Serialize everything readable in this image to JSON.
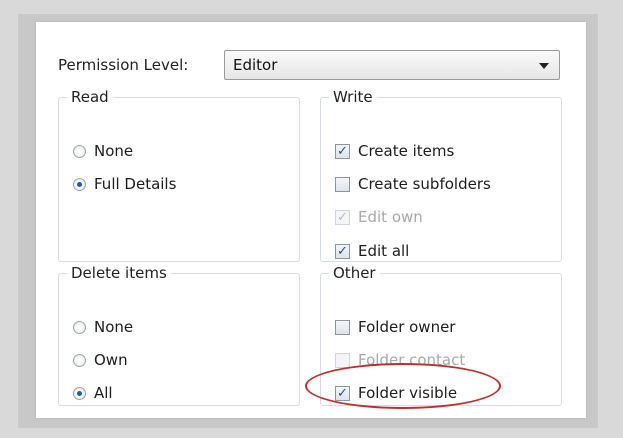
{
  "permission": {
    "label": "Permission Level:",
    "value": "Editor"
  },
  "read": {
    "legend": "Read",
    "options": [
      {
        "label": "None",
        "selected": false
      },
      {
        "label": "Full Details",
        "selected": true
      }
    ]
  },
  "write": {
    "legend": "Write",
    "options": [
      {
        "label": "Create items",
        "checked": true,
        "disabled": false
      },
      {
        "label": "Create subfolders",
        "checked": false,
        "disabled": false
      },
      {
        "label": "Edit own",
        "checked": true,
        "disabled": true
      },
      {
        "label": "Edit all",
        "checked": true,
        "disabled": false
      }
    ]
  },
  "delete": {
    "legend": "Delete items",
    "options": [
      {
        "label": "None",
        "selected": false
      },
      {
        "label": "Own",
        "selected": false
      },
      {
        "label": "All",
        "selected": true
      }
    ]
  },
  "other": {
    "legend": "Other",
    "options": [
      {
        "label": "Folder owner",
        "checked": false,
        "disabled": false
      },
      {
        "label": "Folder contact",
        "checked": false,
        "disabled": true
      },
      {
        "label": "Folder visible",
        "checked": true,
        "disabled": false
      }
    ]
  },
  "checkmark_glyph": "✓",
  "colors": {
    "highlight": "#b83232",
    "accent": "#2a56a6"
  }
}
